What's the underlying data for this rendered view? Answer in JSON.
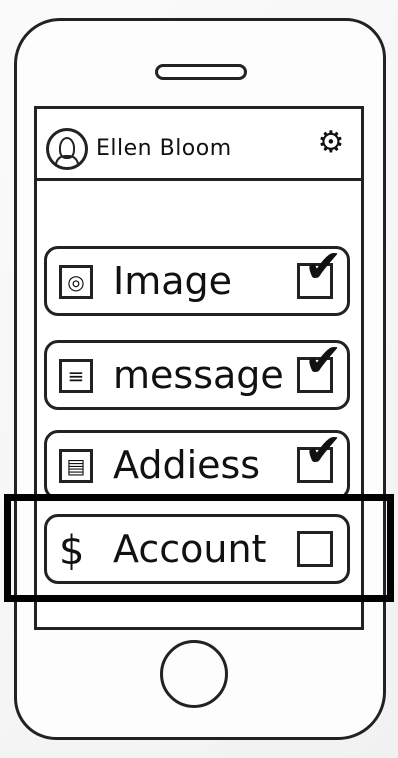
{
  "header": {
    "user_name": "Ellen Bloom",
    "avatar_icon": "avatar-icon",
    "settings_icon": "gear-icon"
  },
  "items": [
    {
      "label": "Image",
      "icon": "camera-icon",
      "checked": true
    },
    {
      "label": "message",
      "icon": "message-icon",
      "checked": true
    },
    {
      "label": "Addiess",
      "icon": "address-card-icon",
      "checked": true
    },
    {
      "label": "Account",
      "icon": "dollar-icon",
      "checked": false,
      "highlighted": true
    }
  ]
}
